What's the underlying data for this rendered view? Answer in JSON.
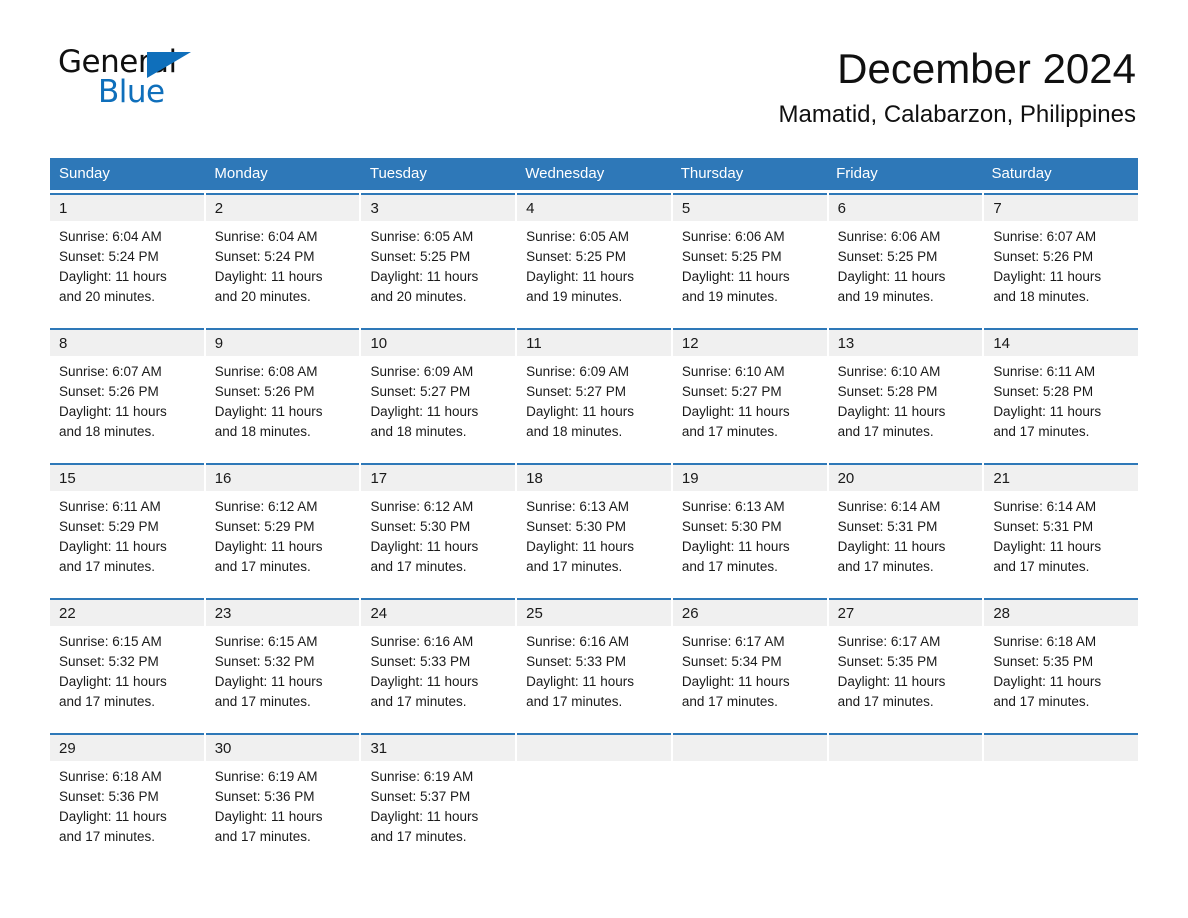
{
  "brand": {
    "name_part1": "General",
    "name_part2": "Blue",
    "accent_color": "#0f6fbb"
  },
  "header": {
    "title": "December 2024",
    "location": "Mamatid, Calabarzon, Philippines"
  },
  "theme": {
    "header_bg": "#2e78b8",
    "daynum_bg": "#f0f0f0",
    "text": "#1a1a1a"
  },
  "weekdays": [
    "Sunday",
    "Monday",
    "Tuesday",
    "Wednesday",
    "Thursday",
    "Friday",
    "Saturday"
  ],
  "weeks": [
    [
      {
        "day": "1",
        "sunrise": "Sunrise: 6:04 AM",
        "sunset": "Sunset: 5:24 PM",
        "daylight1": "Daylight: 11 hours",
        "daylight2": "and 20 minutes."
      },
      {
        "day": "2",
        "sunrise": "Sunrise: 6:04 AM",
        "sunset": "Sunset: 5:24 PM",
        "daylight1": "Daylight: 11 hours",
        "daylight2": "and 20 minutes."
      },
      {
        "day": "3",
        "sunrise": "Sunrise: 6:05 AM",
        "sunset": "Sunset: 5:25 PM",
        "daylight1": "Daylight: 11 hours",
        "daylight2": "and 20 minutes."
      },
      {
        "day": "4",
        "sunrise": "Sunrise: 6:05 AM",
        "sunset": "Sunset: 5:25 PM",
        "daylight1": "Daylight: 11 hours",
        "daylight2": "and 19 minutes."
      },
      {
        "day": "5",
        "sunrise": "Sunrise: 6:06 AM",
        "sunset": "Sunset: 5:25 PM",
        "daylight1": "Daylight: 11 hours",
        "daylight2": "and 19 minutes."
      },
      {
        "day": "6",
        "sunrise": "Sunrise: 6:06 AM",
        "sunset": "Sunset: 5:25 PM",
        "daylight1": "Daylight: 11 hours",
        "daylight2": "and 19 minutes."
      },
      {
        "day": "7",
        "sunrise": "Sunrise: 6:07 AM",
        "sunset": "Sunset: 5:26 PM",
        "daylight1": "Daylight: 11 hours",
        "daylight2": "and 18 minutes."
      }
    ],
    [
      {
        "day": "8",
        "sunrise": "Sunrise: 6:07 AM",
        "sunset": "Sunset: 5:26 PM",
        "daylight1": "Daylight: 11 hours",
        "daylight2": "and 18 minutes."
      },
      {
        "day": "9",
        "sunrise": "Sunrise: 6:08 AM",
        "sunset": "Sunset: 5:26 PM",
        "daylight1": "Daylight: 11 hours",
        "daylight2": "and 18 minutes."
      },
      {
        "day": "10",
        "sunrise": "Sunrise: 6:09 AM",
        "sunset": "Sunset: 5:27 PM",
        "daylight1": "Daylight: 11 hours",
        "daylight2": "and 18 minutes."
      },
      {
        "day": "11",
        "sunrise": "Sunrise: 6:09 AM",
        "sunset": "Sunset: 5:27 PM",
        "daylight1": "Daylight: 11 hours",
        "daylight2": "and 18 minutes."
      },
      {
        "day": "12",
        "sunrise": "Sunrise: 6:10 AM",
        "sunset": "Sunset: 5:27 PM",
        "daylight1": "Daylight: 11 hours",
        "daylight2": "and 17 minutes."
      },
      {
        "day": "13",
        "sunrise": "Sunrise: 6:10 AM",
        "sunset": "Sunset: 5:28 PM",
        "daylight1": "Daylight: 11 hours",
        "daylight2": "and 17 minutes."
      },
      {
        "day": "14",
        "sunrise": "Sunrise: 6:11 AM",
        "sunset": "Sunset: 5:28 PM",
        "daylight1": "Daylight: 11 hours",
        "daylight2": "and 17 minutes."
      }
    ],
    [
      {
        "day": "15",
        "sunrise": "Sunrise: 6:11 AM",
        "sunset": "Sunset: 5:29 PM",
        "daylight1": "Daylight: 11 hours",
        "daylight2": "and 17 minutes."
      },
      {
        "day": "16",
        "sunrise": "Sunrise: 6:12 AM",
        "sunset": "Sunset: 5:29 PM",
        "daylight1": "Daylight: 11 hours",
        "daylight2": "and 17 minutes."
      },
      {
        "day": "17",
        "sunrise": "Sunrise: 6:12 AM",
        "sunset": "Sunset: 5:30 PM",
        "daylight1": "Daylight: 11 hours",
        "daylight2": "and 17 minutes."
      },
      {
        "day": "18",
        "sunrise": "Sunrise: 6:13 AM",
        "sunset": "Sunset: 5:30 PM",
        "daylight1": "Daylight: 11 hours",
        "daylight2": "and 17 minutes."
      },
      {
        "day": "19",
        "sunrise": "Sunrise: 6:13 AM",
        "sunset": "Sunset: 5:30 PM",
        "daylight1": "Daylight: 11 hours",
        "daylight2": "and 17 minutes."
      },
      {
        "day": "20",
        "sunrise": "Sunrise: 6:14 AM",
        "sunset": "Sunset: 5:31 PM",
        "daylight1": "Daylight: 11 hours",
        "daylight2": "and 17 minutes."
      },
      {
        "day": "21",
        "sunrise": "Sunrise: 6:14 AM",
        "sunset": "Sunset: 5:31 PM",
        "daylight1": "Daylight: 11 hours",
        "daylight2": "and 17 minutes."
      }
    ],
    [
      {
        "day": "22",
        "sunrise": "Sunrise: 6:15 AM",
        "sunset": "Sunset: 5:32 PM",
        "daylight1": "Daylight: 11 hours",
        "daylight2": "and 17 minutes."
      },
      {
        "day": "23",
        "sunrise": "Sunrise: 6:15 AM",
        "sunset": "Sunset: 5:32 PM",
        "daylight1": "Daylight: 11 hours",
        "daylight2": "and 17 minutes."
      },
      {
        "day": "24",
        "sunrise": "Sunrise: 6:16 AM",
        "sunset": "Sunset: 5:33 PM",
        "daylight1": "Daylight: 11 hours",
        "daylight2": "and 17 minutes."
      },
      {
        "day": "25",
        "sunrise": "Sunrise: 6:16 AM",
        "sunset": "Sunset: 5:33 PM",
        "daylight1": "Daylight: 11 hours",
        "daylight2": "and 17 minutes."
      },
      {
        "day": "26",
        "sunrise": "Sunrise: 6:17 AM",
        "sunset": "Sunset: 5:34 PM",
        "daylight1": "Daylight: 11 hours",
        "daylight2": "and 17 minutes."
      },
      {
        "day": "27",
        "sunrise": "Sunrise: 6:17 AM",
        "sunset": "Sunset: 5:35 PM",
        "daylight1": "Daylight: 11 hours",
        "daylight2": "and 17 minutes."
      },
      {
        "day": "28",
        "sunrise": "Sunrise: 6:18 AM",
        "sunset": "Sunset: 5:35 PM",
        "daylight1": "Daylight: 11 hours",
        "daylight2": "and 17 minutes."
      }
    ],
    [
      {
        "day": "29",
        "sunrise": "Sunrise: 6:18 AM",
        "sunset": "Sunset: 5:36 PM",
        "daylight1": "Daylight: 11 hours",
        "daylight2": "and 17 minutes."
      },
      {
        "day": "30",
        "sunrise": "Sunrise: 6:19 AM",
        "sunset": "Sunset: 5:36 PM",
        "daylight1": "Daylight: 11 hours",
        "daylight2": "and 17 minutes."
      },
      {
        "day": "31",
        "sunrise": "Sunrise: 6:19 AM",
        "sunset": "Sunset: 5:37 PM",
        "daylight1": "Daylight: 11 hours",
        "daylight2": "and 17 minutes."
      },
      {
        "day": "",
        "sunrise": "",
        "sunset": "",
        "daylight1": "",
        "daylight2": ""
      },
      {
        "day": "",
        "sunrise": "",
        "sunset": "",
        "daylight1": "",
        "daylight2": ""
      },
      {
        "day": "",
        "sunrise": "",
        "sunset": "",
        "daylight1": "",
        "daylight2": ""
      },
      {
        "day": "",
        "sunrise": "",
        "sunset": "",
        "daylight1": "",
        "daylight2": ""
      }
    ]
  ]
}
